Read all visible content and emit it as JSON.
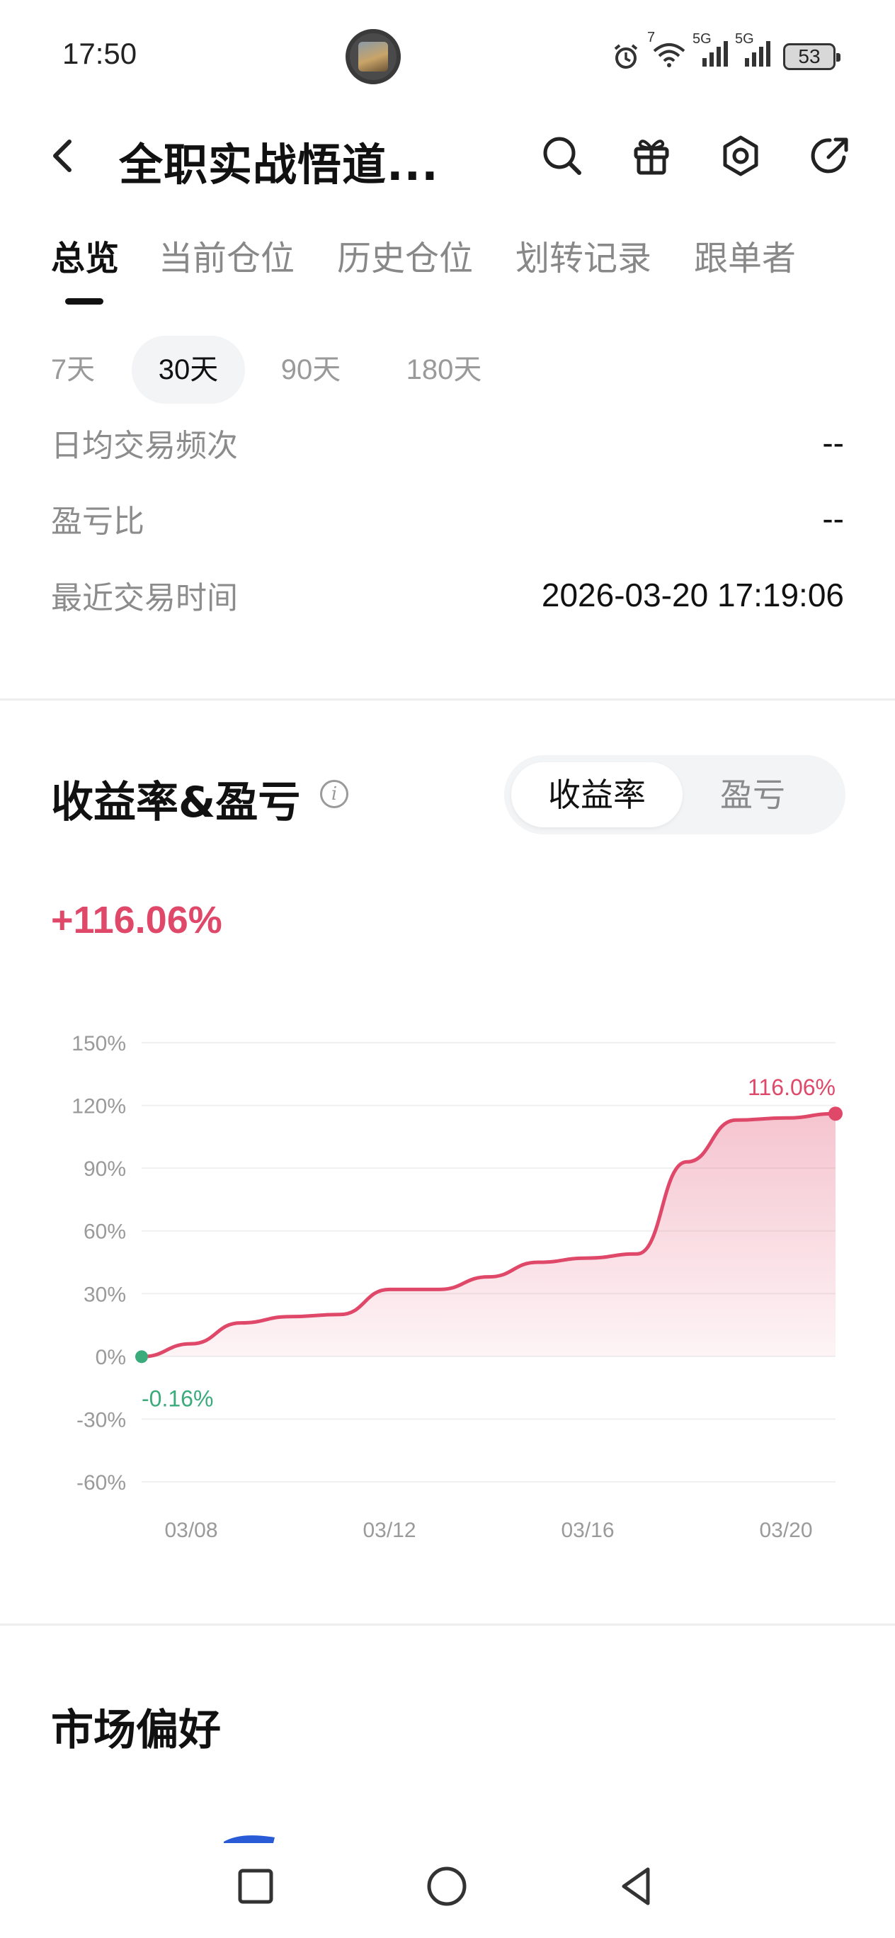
{
  "status_bar": {
    "time": "17:50",
    "signal_labels": [
      "7",
      "5G",
      "5G"
    ],
    "battery": "53",
    "icons": [
      "alarm-icon",
      "wifi-icon",
      "signal-icon",
      "signal-icon",
      "battery-icon"
    ]
  },
  "header": {
    "title": "全职实战悟道...",
    "icons": [
      "back-icon",
      "search-icon",
      "gift-icon",
      "settings-icon",
      "share-icon"
    ]
  },
  "tabs": [
    "总览",
    "当前仓位",
    "历史仓位",
    "划转记录",
    "跟单者"
  ],
  "active_tab": 0,
  "periods": [
    "7天",
    "30天",
    "90天",
    "180天"
  ],
  "active_period": 1,
  "stats": [
    {
      "label": "日均交易频次",
      "value": "--"
    },
    {
      "label": "盈亏比",
      "value": "--"
    },
    {
      "label": "最近交易时间",
      "value": "2026-03-20 17:19:06"
    }
  ],
  "pnl_section": {
    "title": "收益率&盈亏",
    "toggle": [
      "收益率",
      "盈亏"
    ],
    "active_toggle": 0,
    "headline_value": "+116.06%"
  },
  "colors": {
    "accent_red": "#e0486a",
    "accent_green": "#3bab7c"
  },
  "chart_data": {
    "type": "area",
    "x": [
      "03/07",
      "03/08",
      "03/09",
      "03/10",
      "03/11",
      "03/12",
      "03/13",
      "03/14",
      "03/15",
      "03/16",
      "03/17",
      "03/18",
      "03/19",
      "03/20",
      "03/21"
    ],
    "series": [
      {
        "values": [
          -0.16,
          6,
          16,
          19,
          20,
          32,
          32,
          38,
          45,
          47,
          49,
          93,
          113,
          114,
          116.06
        ]
      }
    ],
    "yticks": [
      "150%",
      "120%",
      "90%",
      "60%",
      "30%",
      "0%",
      "-30%",
      "-60%"
    ],
    "xticks": [
      "03/08",
      "03/12",
      "03/16",
      "03/20"
    ],
    "ylim": [
      -60,
      150
    ],
    "grid": true,
    "annotations": {
      "start": "-0.16%",
      "end": "116.06%"
    }
  },
  "market_section": {
    "title": "市场偏好"
  },
  "navbar": {
    "icons": [
      "recent-apps-icon",
      "home-icon",
      "back-nav-icon"
    ]
  }
}
